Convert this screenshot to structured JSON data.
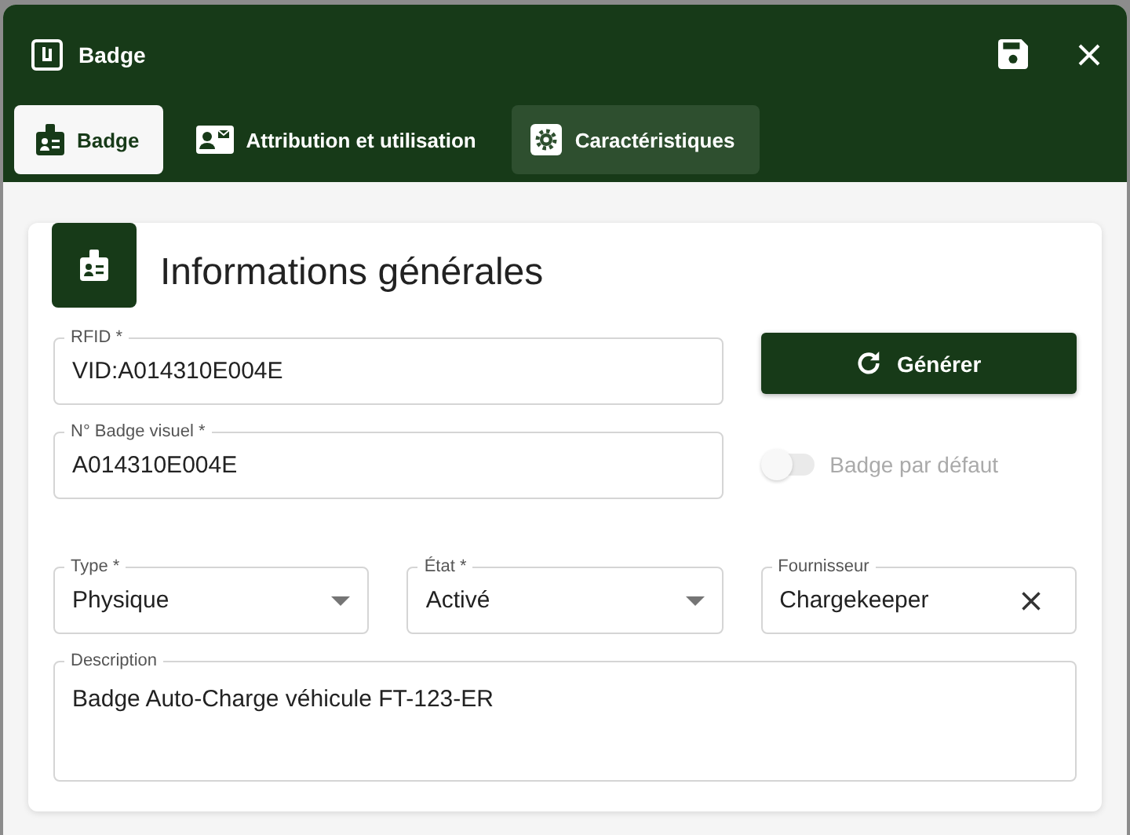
{
  "window": {
    "title": "Badge"
  },
  "tabs": [
    {
      "label": "Badge",
      "selected": true,
      "hovered": false
    },
    {
      "label": "Attribution et utilisation",
      "selected": false,
      "hovered": false
    },
    {
      "label": "Caractéristiques",
      "selected": false,
      "hovered": true
    }
  ],
  "section": {
    "title": "Informations générales"
  },
  "fields": [
    {
      "kind": "text",
      "label": "RFID *",
      "value": "VID:A014310E004E"
    },
    {
      "kind": "button",
      "label": "Générer"
    },
    {
      "kind": "text",
      "label": "N° Badge visuel *",
      "value": "A014310E004E"
    },
    {
      "kind": "toggle",
      "label": "Badge par défaut",
      "on": false,
      "disabled": true
    },
    {
      "kind": "select",
      "label": "Type *",
      "value": "Physique"
    },
    {
      "kind": "select",
      "label": "État *",
      "value": "Activé"
    },
    {
      "kind": "clearable",
      "label": "Fournisseur",
      "value": "Chargekeeper"
    },
    {
      "kind": "textarea",
      "label": "Description",
      "value": "Badge Auto-Charge véhicule FT-123-ER"
    }
  ]
}
